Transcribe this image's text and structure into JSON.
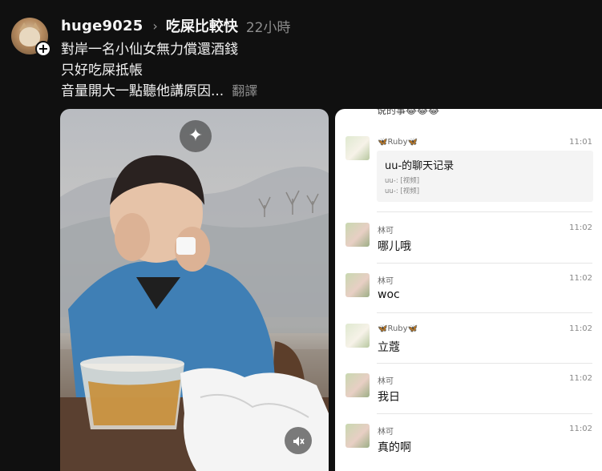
{
  "post": {
    "username": "huge9025",
    "community": "吃屎比較快",
    "time_ago": "22小時",
    "follow_symbol": "+",
    "caption_lines": [
      "對岸一名小仙女無力償還酒錢",
      "只好吃屎抵帳",
      "音量開大一點聽他講原因..."
    ],
    "translate_label": "翻譯",
    "icons": {
      "avatar": "cat-avatar",
      "chevron": "chevron-right-icon",
      "sparkle": "sparkle-icon",
      "mute": "speaker-muted-icon"
    }
  },
  "chat": {
    "clipped_top_text": "说的事😂😂😂",
    "messages": [
      {
        "name": "🦋Ruby🦋",
        "time": "11:01",
        "avatar": "sheep",
        "card": {
          "title": "uu-的聊天记录",
          "lines": [
            "uu-: [视频]",
            "uu-: [视频]"
          ]
        }
      },
      {
        "name": "林可",
        "time": "11:02",
        "avatar": "girl",
        "text": "哪儿哦"
      },
      {
        "name": "林可",
        "time": "11:02",
        "avatar": "girl",
        "text": "woc"
      },
      {
        "name": "🦋Ruby🦋",
        "time": "11:02",
        "avatar": "sheep",
        "text": "立蔻"
      },
      {
        "name": "林可",
        "time": "11:02",
        "avatar": "girl",
        "text": "我日"
      },
      {
        "name": "林可",
        "time": "11:02",
        "avatar": "girl",
        "text": "真的啊"
      }
    ]
  },
  "colors": {
    "background": "#101010",
    "chat_bg": "#ffffff",
    "muted_text": "#8e8e8e"
  }
}
